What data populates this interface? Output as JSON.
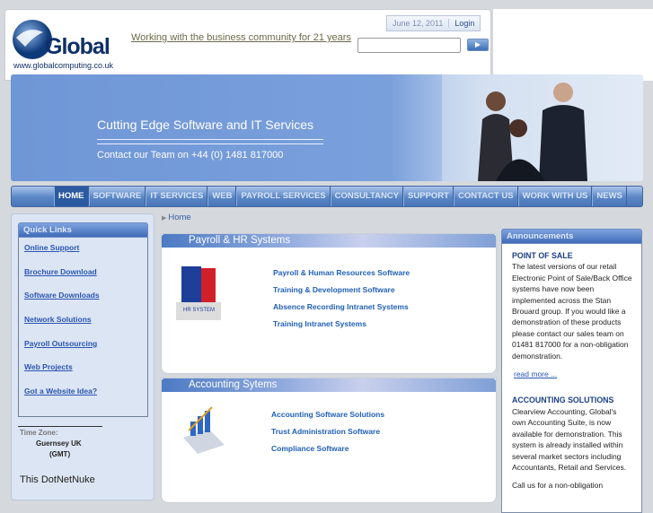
{
  "header": {
    "logo_text": "Global",
    "logo_url": "www.globalcomputing.co.uk",
    "tagline": "Working with the business community for 21 years",
    "date": "June 12, 2011",
    "login": "Login",
    "search_placeholder": "",
    "search_button_icon": "play-arrow-icon"
  },
  "banner": {
    "headline": "Cutting Edge Software and  IT Services",
    "contact": "Contact our Team on +44  (0) 1481 817000"
  },
  "nav": [
    "HOME",
    "SOFTWARE",
    "IT SERVICES",
    "WEB",
    "PAYROLL SERVICES",
    "CONSULTANCY",
    "SUPPORT",
    "CONTACT US",
    "WORK WITH US",
    "NEWS"
  ],
  "quick_links": {
    "title": "Quick Links",
    "items": [
      "Online Support",
      "Brochure Download",
      "Software Downloads",
      "Network Solutions",
      "Payroll Outsourcing",
      "Web Projects",
      "Got a Website Idea?"
    ]
  },
  "timezone": {
    "label": "Time Zone:",
    "zone": "Guernsey UK",
    "abbr": "(GMT)"
  },
  "footer_text": "This DotNetNuke",
  "breadcrumb": "Home",
  "sections": [
    {
      "title": "Payroll & HR Systems",
      "image_label": "HR SYSTEM",
      "links": [
        "Payroll & Human Resources Software",
        "Training & Development Software",
        "Absence Recording Intranet Systems",
        "Training Intranet Systems"
      ]
    },
    {
      "title": "Accounting Sytems",
      "links": [
        "Accounting Software Solutions",
        "Trust Administration Software",
        "Compliance Software"
      ]
    }
  ],
  "announcements": {
    "title": "Announcements",
    "items": [
      {
        "heading": "POINT OF SALE",
        "body": "The latest versions of our retail Electronic Point of Sale/Back Office systems have now been implemented across the Stan Brouard group. If you would like a demonstration of these products please contact our sales team on 01481 817000 for a non-obligation demonstration.",
        "more": "read more ..."
      },
      {
        "heading": "ACCOUNTING SOLUTIONS",
        "body": "Clearview Accounting, Global's own Accounting Suite, is now available for demonstration. This system is already installed within several market sectors including Accountants, Retail and Services.",
        "tail": "Call us for a non-obligation"
      }
    ]
  }
}
